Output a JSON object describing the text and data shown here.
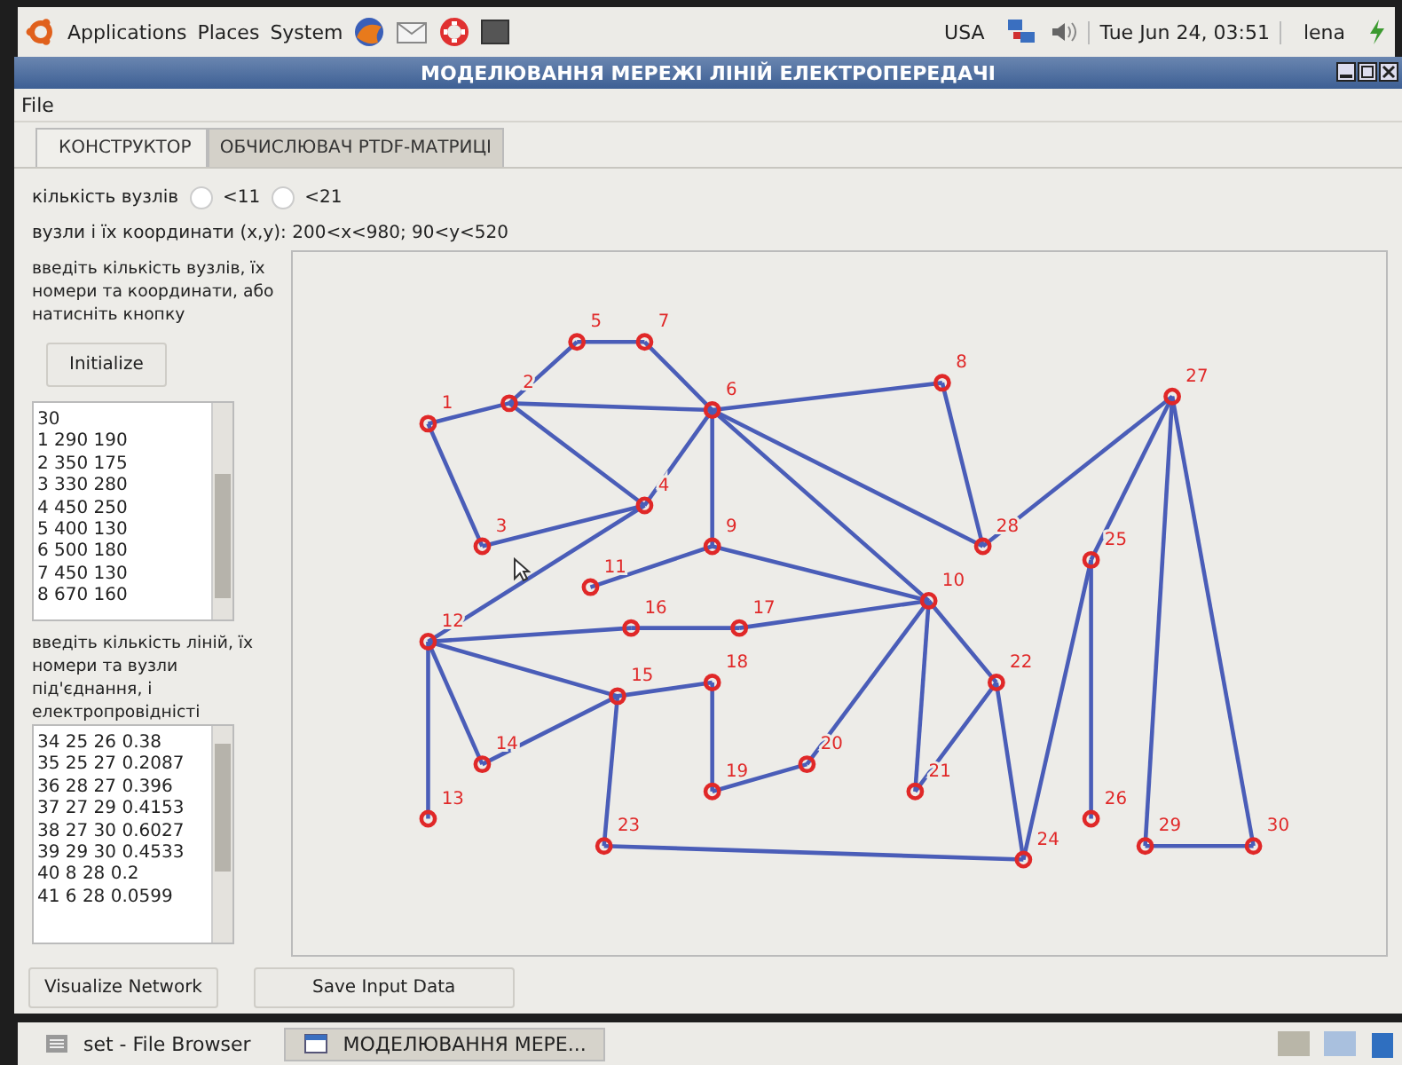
{
  "top_panel": {
    "menus": [
      "Applications",
      "Places",
      "System"
    ],
    "keyboard": "USA",
    "clock": "Tue Jun 24, 03:51",
    "user": "lena"
  },
  "window": {
    "title": "МОДЕЛЮВАННЯ МЕРЕЖІ ЛІНІЙ ЕЛЕКТРОПЕРЕДАЧІ"
  },
  "menu": [
    "File"
  ],
  "tabs": [
    {
      "label": "КОНСТРУКТОР",
      "selected": true
    },
    {
      "label": "ОБЧИСЛЮВАЧ PTDF-МАТРИЦІ",
      "selected": false
    }
  ],
  "node_count": {
    "label": "кількість вузлів",
    "options": [
      {
        "label": "<11",
        "selected": false
      },
      {
        "label": "<21",
        "selected": false
      }
    ]
  },
  "coords_hint": "вузли і їх координати (x,y):  200<x<980; 90<y<520",
  "nodes_prompt": "введіть кількість вузлів, їх номери та координати, або натисніть кнопку",
  "initialize_button": "Initialize",
  "nodes_text": [
    "30",
    "1 290 190",
    "2 350 175",
    "3 330 280",
    "4 450 250",
    "5 400 130",
    "6 500 180",
    "7 450 130",
    "8 670 160"
  ],
  "lines_prompt": "введіть кількість ліній, їх номери та  вузли  під'єднання, і електропровідністі",
  "lines_text": [
    "34 25 26 0.38",
    "35 25 27 0.2087",
    "36 28 27 0.396",
    "37 27 29 0.4153",
    "38 27 30 0.6027",
    "39 29 30 0.4533",
    "40 8 28 0.2",
    "41 6 28 0.0599"
  ],
  "network": {
    "nodes": [
      {
        "label": "1"
      },
      {
        "label": "2"
      },
      {
        "label": "3"
      },
      {
        "label": "4"
      },
      {
        "label": "5"
      },
      {
        "label": "6"
      },
      {
        "label": "7"
      },
      {
        "label": "8"
      },
      {
        "label": "9"
      },
      {
        "label": "10"
      },
      {
        "label": "11"
      },
      {
        "label": "12"
      },
      {
        "label": "13"
      },
      {
        "label": "14"
      },
      {
        "label": "15"
      },
      {
        "label": "16"
      },
      {
        "label": "17"
      },
      {
        "label": "18"
      },
      {
        "label": "19"
      },
      {
        "label": "20"
      },
      {
        "label": "21"
      },
      {
        "label": "22"
      },
      {
        "label": "23"
      },
      {
        "label": "24"
      },
      {
        "label": "25"
      },
      {
        "label": "26"
      },
      {
        "label": "27"
      },
      {
        "label": "28"
      },
      {
        "label": "29"
      },
      {
        "label": "30"
      }
    ]
  },
  "buttons": [
    "Visualize Network",
    "Save Input Data"
  ],
  "taskbar": [
    {
      "label": "set - File Browser",
      "selected": false
    },
    {
      "label": "МОДЕЛЮВАННЯ МЕРЕ...",
      "selected": true
    }
  ]
}
